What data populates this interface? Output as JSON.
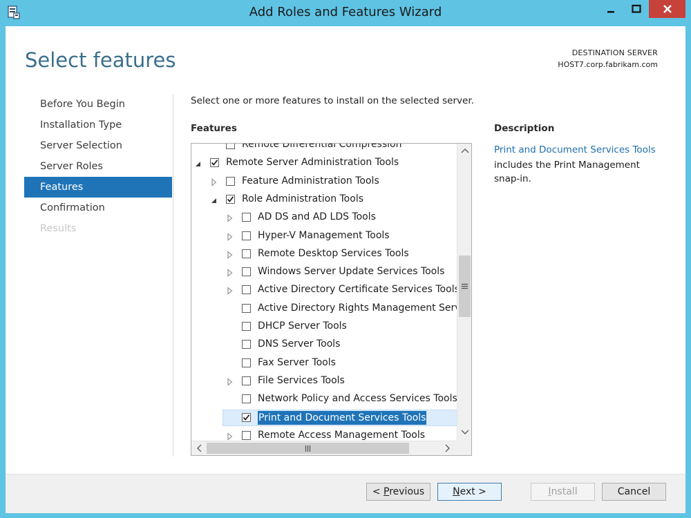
{
  "window": {
    "title": "Add Roles and Features Wizard",
    "colors": {
      "frame": "#5fc3e4",
      "close": "#c7423a",
      "accent": "#1f74b8",
      "title": "#3a6f8d"
    }
  },
  "header": {
    "page_title": "Select features",
    "destination_label": "DESTINATION SERVER",
    "destination_host": "HOST7.corp.fabrikam.com"
  },
  "nav": {
    "items": [
      {
        "label": "Before You Begin",
        "state": "normal"
      },
      {
        "label": "Installation Type",
        "state": "normal"
      },
      {
        "label": "Server Selection",
        "state": "normal"
      },
      {
        "label": "Server Roles",
        "state": "normal"
      },
      {
        "label": "Features",
        "state": "active"
      },
      {
        "label": "Confirmation",
        "state": "normal"
      },
      {
        "label": "Results",
        "state": "disabled"
      }
    ]
  },
  "main": {
    "instruction": "Select one or more features to install on the selected server.",
    "features_heading": "Features",
    "tree": [
      {
        "label": "Remote Differential Compression",
        "checked": false,
        "expander": "none"
      },
      {
        "label": "Remote Server Administration Tools",
        "checked": true,
        "expander": "expanded"
      },
      {
        "label": "Feature Administration Tools",
        "checked": false,
        "expander": "collapsed"
      },
      {
        "label": "Role Administration Tools",
        "checked": true,
        "expander": "expanded"
      },
      {
        "label": "AD DS and AD LDS Tools",
        "checked": false,
        "expander": "collapsed"
      },
      {
        "label": "Hyper-V Management Tools",
        "checked": false,
        "expander": "collapsed"
      },
      {
        "label": "Remote Desktop Services Tools",
        "checked": false,
        "expander": "collapsed"
      },
      {
        "label": "Windows Server Update Services Tools",
        "checked": false,
        "expander": "collapsed"
      },
      {
        "label": "Active Directory Certificate Services Tools",
        "checked": false,
        "expander": "collapsed"
      },
      {
        "label": "Active Directory Rights Management Servic",
        "checked": false,
        "expander": "none"
      },
      {
        "label": "DHCP Server Tools",
        "checked": false,
        "expander": "none"
      },
      {
        "label": "DNS Server Tools",
        "checked": false,
        "expander": "none"
      },
      {
        "label": "Fax Server Tools",
        "checked": false,
        "expander": "none"
      },
      {
        "label": "File Services Tools",
        "checked": false,
        "expander": "collapsed"
      },
      {
        "label": "Network Policy and Access Services Tools",
        "checked": false,
        "expander": "none"
      },
      {
        "label": "Print and Document Services Tools",
        "checked": true,
        "expander": "none",
        "selected": true
      },
      {
        "label": "Remote Access Management Tools",
        "checked": false,
        "expander": "collapsed"
      }
    ],
    "description_heading": "Description",
    "description_link": "Print and Document Services Tools",
    "description_text": "includes the Print Management snap-in."
  },
  "footer": {
    "previous_label": "< Previous",
    "next_label": "Next >",
    "install_label": "Install",
    "cancel_label": "Cancel"
  }
}
